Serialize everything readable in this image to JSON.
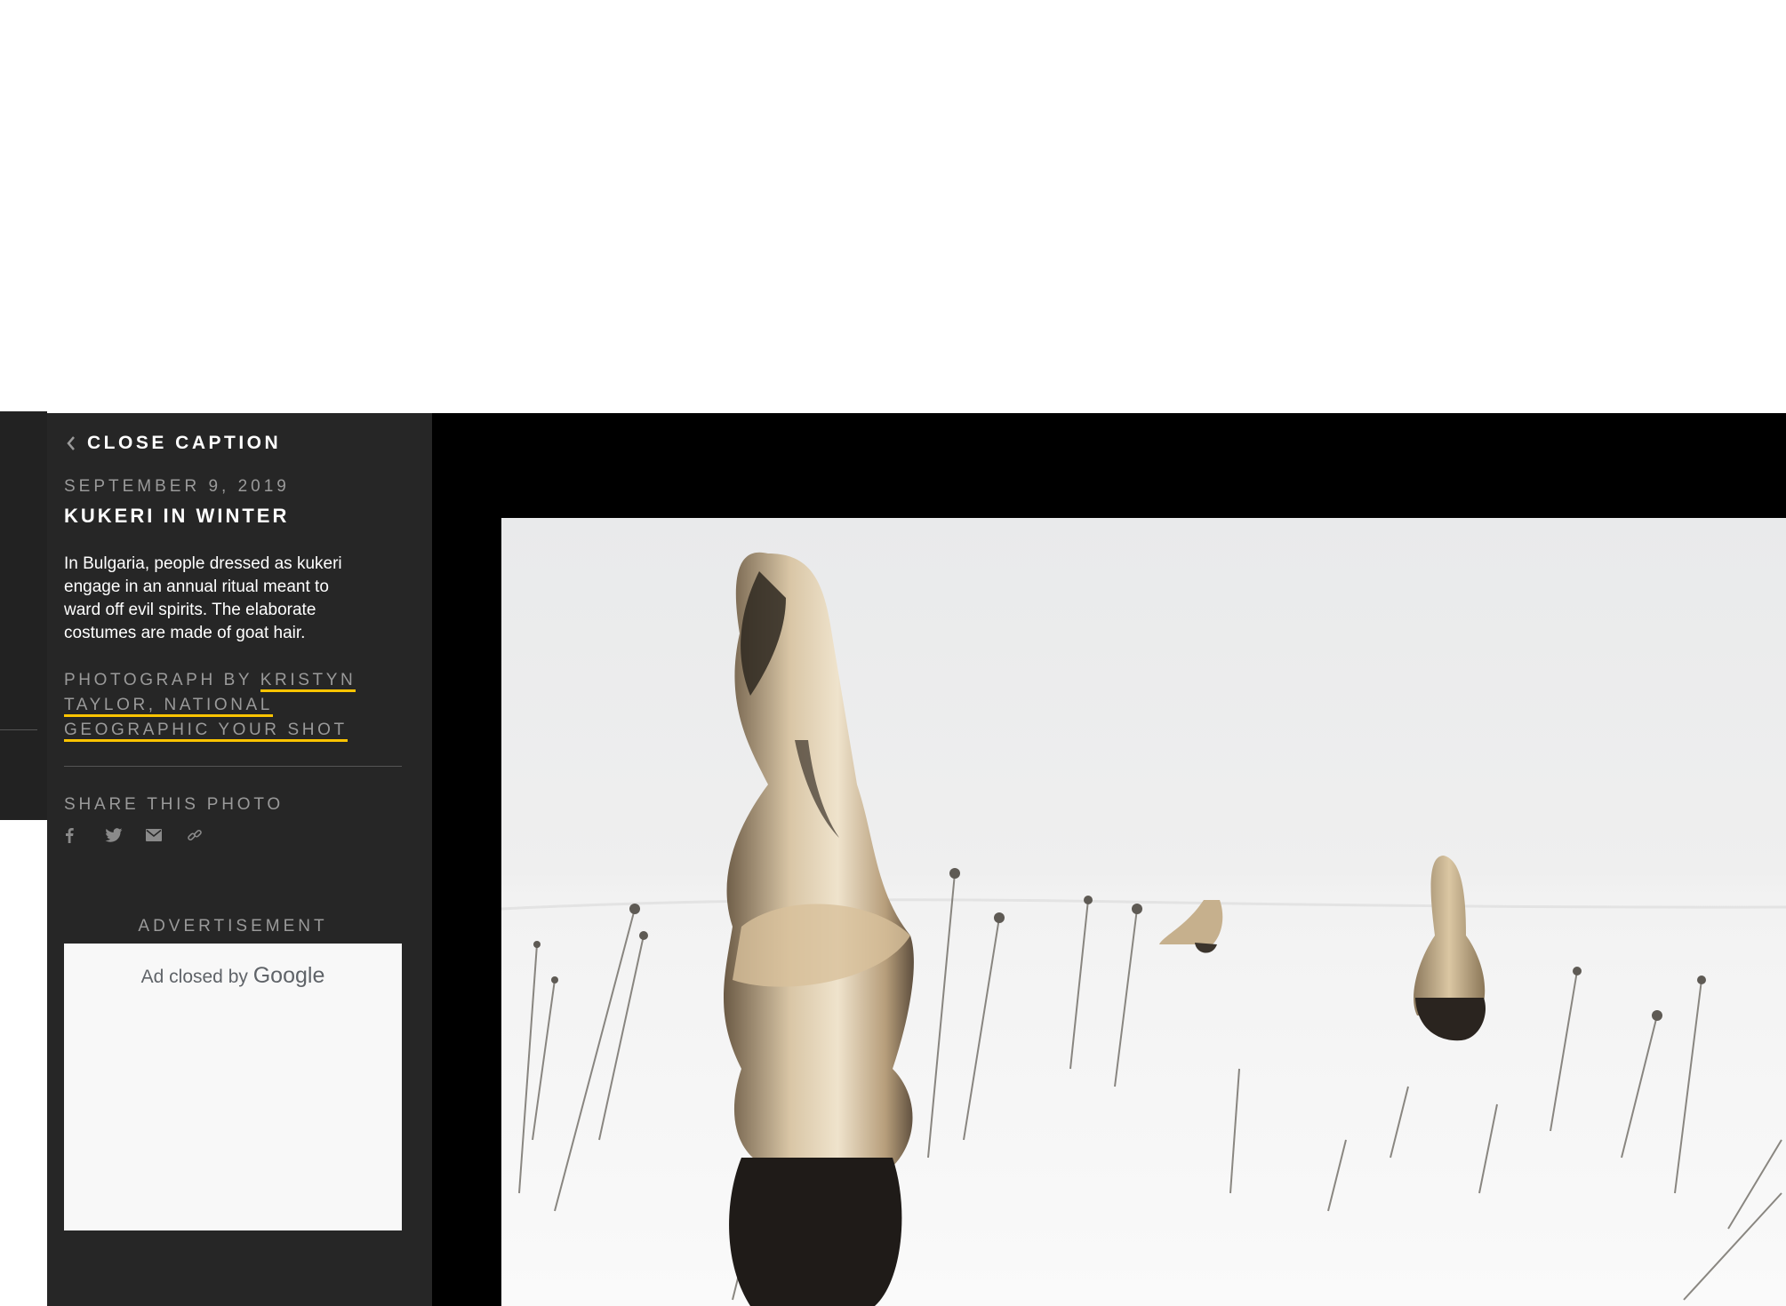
{
  "caption": {
    "close_label": "CLOSE CAPTION",
    "date": "SEPTEMBER 9, 2019",
    "title": "KUKERI IN WINTER",
    "description": "In Bulgaria, people dressed as kukeri engage in an annual ritual meant to ward off evil spirits. The elaborate costumes are made of goat hair.",
    "credit_prefix": "PHOTOGRAPH BY ",
    "credit_line1": "KRISTYN",
    "credit_line2": "TAYLOR, NATIONAL",
    "credit_line3": "GEOGRAPHIC YOUR SHOT",
    "share_label": "SHARE THIS PHOTO",
    "share_icons": [
      "facebook-icon",
      "twitter-icon",
      "email-icon",
      "link-icon"
    ]
  },
  "advertisement": {
    "label": "ADVERTISEMENT",
    "closed_text": "Ad closed by",
    "brand": "Google"
  },
  "colors": {
    "panel_bg": "#262626",
    "stage_bg": "#000000",
    "link_underline": "#fcc400",
    "muted_text": "#9a9a9a"
  }
}
